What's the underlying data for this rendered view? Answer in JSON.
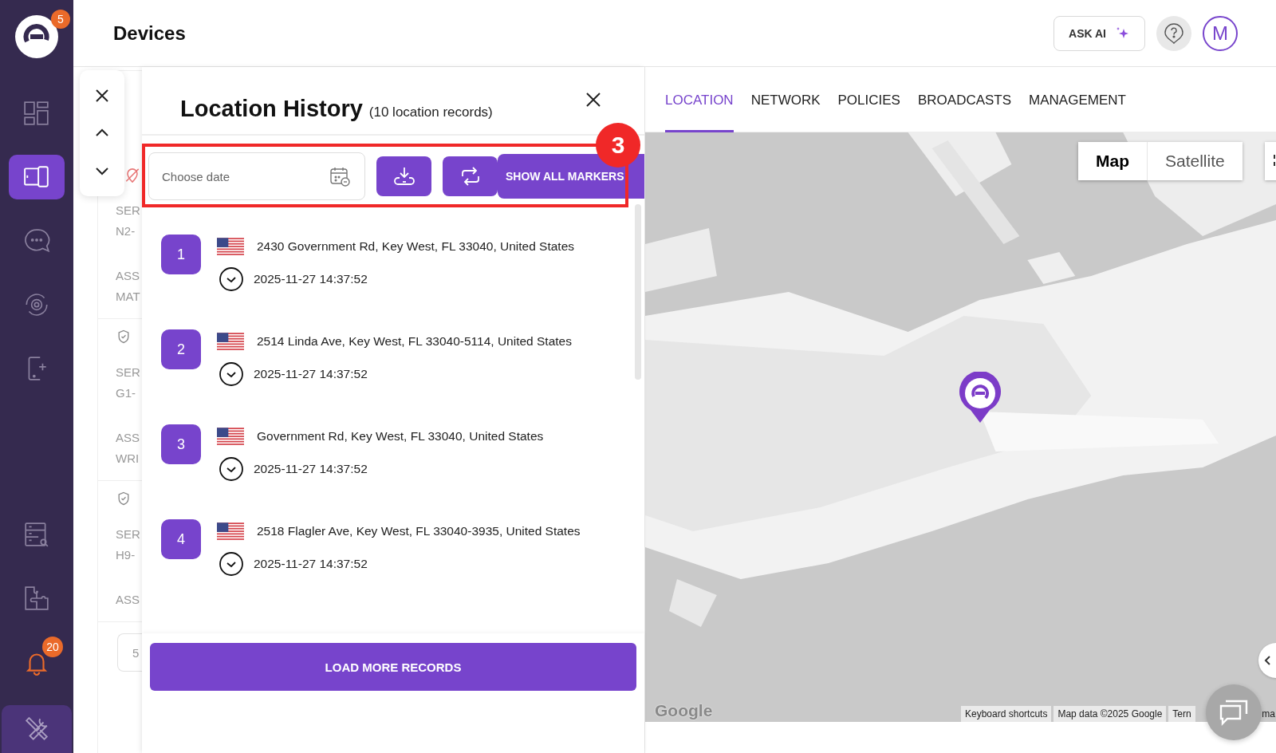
{
  "sidebar": {
    "logo_badge": "5",
    "items": [
      {
        "kind": "dashboard",
        "selected": false
      },
      {
        "kind": "devices",
        "selected": true
      },
      {
        "kind": "chat",
        "selected": false
      },
      {
        "kind": "settings-sync",
        "selected": false
      },
      {
        "kind": "add-device",
        "selected": false
      },
      {
        "kind": "server-search",
        "selected": false
      },
      {
        "kind": "puzzle",
        "selected": false
      },
      {
        "kind": "bell",
        "selected": false,
        "badge": "20"
      }
    ],
    "footer_item": {
      "kind": "tools"
    }
  },
  "header": {
    "title": "Devices",
    "ask_ai": "ASK AI",
    "avatar": "M"
  },
  "background_card": {
    "blocks": [
      {
        "kind": "pin",
        "lines": [
          "SER",
          "N2-",
          "ASS",
          "MAT"
        ]
      },
      {
        "kind": "shield",
        "lines": [
          "SER",
          "G1-",
          "ASS",
          "WRI"
        ]
      },
      {
        "kind": "shield",
        "lines": [
          "SER",
          "H9-",
          "ASS"
        ]
      }
    ],
    "field_value": "5"
  },
  "location_history": {
    "title": "Location History",
    "subtitle": "(10 location records)",
    "date_field": {
      "placeholder": "Choose date"
    },
    "show_all": "SHOW ALL MARKERS",
    "annotation": "3",
    "records": [
      {
        "number": "1",
        "address": "2430 Government Rd, Key West, FL 33040, United States",
        "time": "2025-11-27 14:37:52"
      },
      {
        "number": "2",
        "address": "2514 Linda Ave, Key West, FL 33040-5114, United States",
        "time": "2025-11-27 14:37:52"
      },
      {
        "number": "3",
        "address": "Government Rd, Key West, FL 33040, United States",
        "time": "2025-11-27 14:37:52"
      },
      {
        "number": "4",
        "address": "2518 Flagler Ave, Key West, FL 33040-3935, United States",
        "time": "2025-11-27 14:37:52"
      }
    ],
    "load_more": "LOAD MORE RECORDS"
  },
  "tabs": [
    {
      "label": "LOCATION",
      "selected": true
    },
    {
      "label": "NETWORK",
      "selected": false
    },
    {
      "label": "POLICIES",
      "selected": false
    },
    {
      "label": "BROADCASTS",
      "selected": false
    },
    {
      "label": "MANAGEMENT",
      "selected": false
    }
  ],
  "map": {
    "kind": "picture",
    "types": [
      {
        "label": "Map",
        "selected": true
      },
      {
        "label": "Satellite",
        "selected": false
      }
    ],
    "google": "Google",
    "attribution": [
      "Keyboard shortcuts",
      "Map data ©2025 Google",
      "Tern",
      "ma"
    ]
  }
}
